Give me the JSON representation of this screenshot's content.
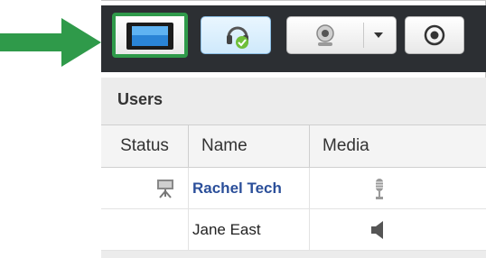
{
  "toolbar": {
    "buttons": [
      {
        "name": "share-screen",
        "icon": "monitor-icon",
        "selected": true
      },
      {
        "name": "audio",
        "icon": "headset-icon"
      },
      {
        "name": "webcam",
        "icon": "webcam-icon",
        "has_dropdown": true
      },
      {
        "name": "record",
        "icon": "record-icon"
      }
    ],
    "highlight_color": "#2f9a4a"
  },
  "users_panel": {
    "title": "Users",
    "columns": [
      "Status",
      "Name",
      "Media"
    ],
    "rows": [
      {
        "status_icon": "presenter-icon",
        "name": "Rachel Tech",
        "media_icon": "microphone-icon",
        "highlighted": true
      },
      {
        "status_icon": "",
        "name": "Jane East",
        "media_icon": "speaker-icon",
        "highlighted": false
      }
    ]
  },
  "colors": {
    "toolbar_bg": "#2c2f33",
    "panel_bg": "#ececec",
    "presenter_name": "#2b4f9a",
    "arrow": "#2f9a4a"
  }
}
